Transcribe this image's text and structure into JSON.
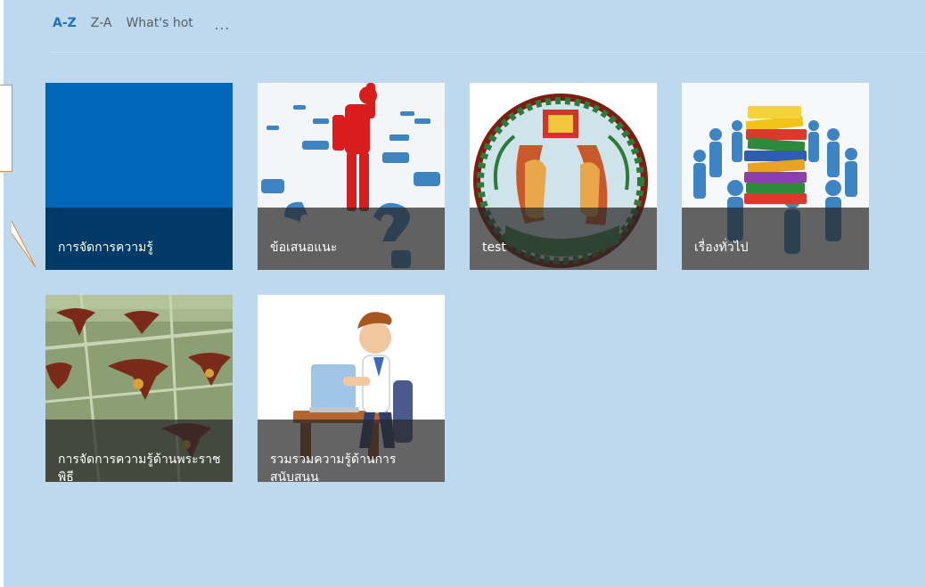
{
  "sort": {
    "az": "A-Z",
    "za": "Z-A",
    "hot": "What's hot",
    "more": "..."
  },
  "tiles": [
    {
      "label": "การจัดการความรู้"
    },
    {
      "label": "ข้อเสนอแนะ"
    },
    {
      "label": "test"
    },
    {
      "label": "เรื่องทั่วไป"
    },
    {
      "label": "การจัดการความรู้ด้านพระราชพิธี"
    },
    {
      "label": "รวมรวมความรู้ด้านการสนับสนุน"
    }
  ],
  "colors": {
    "accent": "#1e73be",
    "panel": "#bed9ee",
    "tile_solid": "#0067b8"
  }
}
